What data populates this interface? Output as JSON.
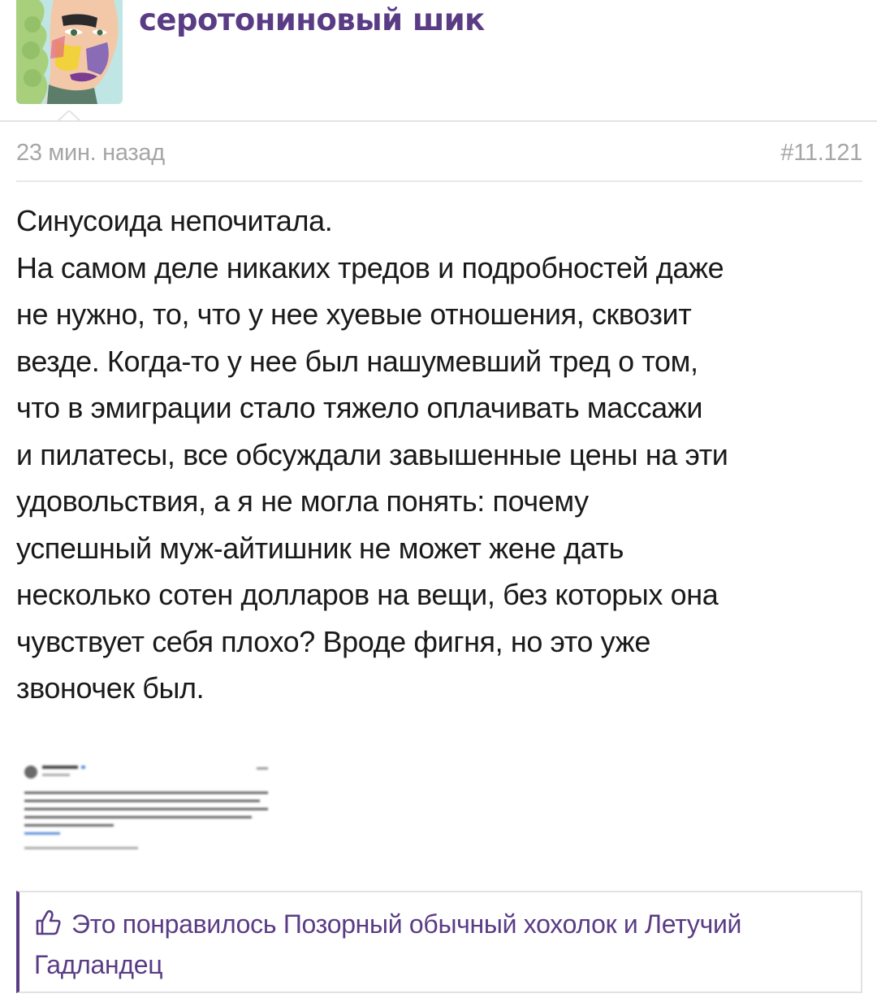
{
  "post": {
    "author": "серотониновый шик",
    "time": "23 мин. назад",
    "number": "#11.121",
    "lines": [
      "Синусоида непочитала.",
      "На самом деле никаких тредов и подробностей даже",
      "не нужно, то, что у нее хуевые отношения, сквозит",
      "везде. Когда-то у нее был нашумевший тред о том,",
      "что в эмиграции стало тяжело оплачивать массажи",
      "и пилатесы, все обсуждали завышенные цены на эти",
      "удовольствия, а я не могла понять: почему",
      "успешный муж-айтишник не может жене дать",
      "несколько сотен долларов на вещи, без которых она",
      "чувствует себя плохо? Вроде фигня, но это уже",
      "звоночек был."
    ]
  },
  "likes": {
    "text": "Это понравилось Позорный обычный хохолок и Летучий Гадландец"
  },
  "colors": {
    "accent": "#5a3c85",
    "meta": "#a6a6a6",
    "text": "#1a1a1a"
  },
  "icons": {
    "like": "thumbs-up-icon"
  }
}
